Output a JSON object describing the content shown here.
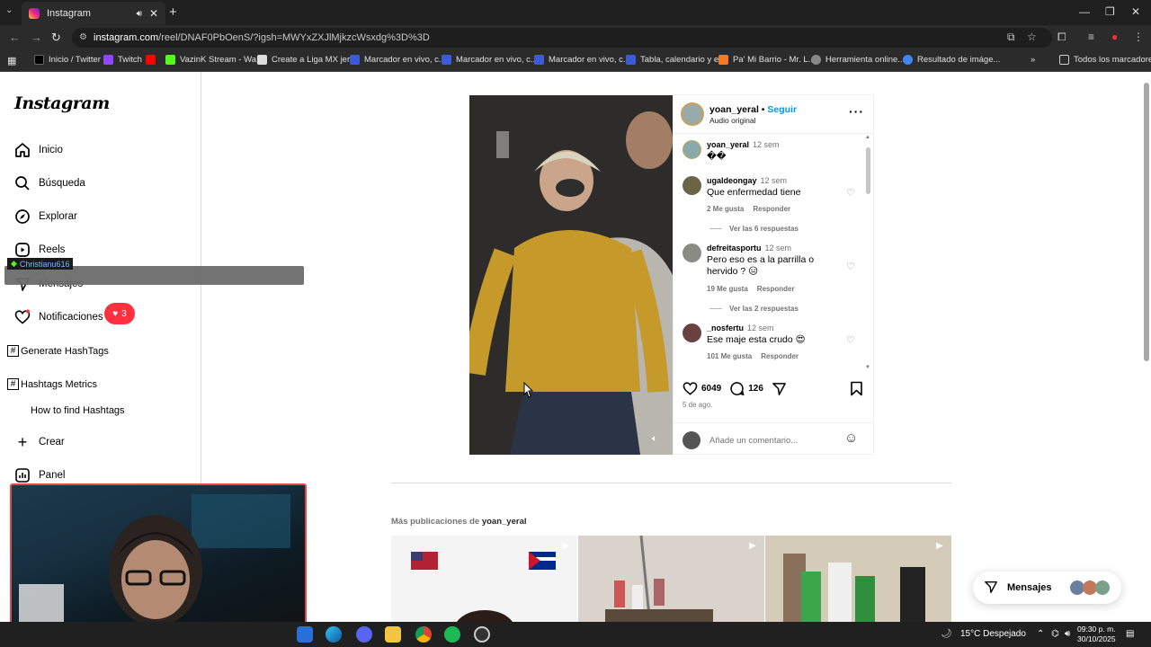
{
  "browser": {
    "tab_title": "Instagram",
    "url_host": "instagram.com",
    "url_path": "/reel/DNAF0PbOenS/?igsh=MWYxZXJlMjkzcWsxdg%3D%3D",
    "bookmarks": [
      "Inicio / Twitter",
      "Twitch",
      "",
      "VazinK Stream - Wa...",
      "Create a Liga MX jer...",
      "Marcador en vivo, c...",
      "Marcador en vivo, c...",
      "Marcador en vivo, c...",
      "Tabla, calendario y e...",
      "Pa' Mi Barrio - Mr. L...",
      "Herramienta online...",
      "Resultado de imáge..."
    ],
    "all_bookmarks": "Todos los marcadores"
  },
  "sidebar": {
    "logo": "Instagram",
    "items": [
      {
        "label": "Inicio",
        "icon": "home-icon"
      },
      {
        "label": "Búsqueda",
        "icon": "search-icon"
      },
      {
        "label": "Explorar",
        "icon": "compass-icon"
      },
      {
        "label": "Reels",
        "icon": "reels-icon"
      },
      {
        "label": "Mensajes",
        "icon": "messenger-icon"
      },
      {
        "label": "Notificaciones",
        "icon": "heart-icon"
      }
    ],
    "notif_count": "3",
    "generate_hashtags": "Generate HashTags",
    "hashtags_metrics": "Hashtags Metrics",
    "how_to": "How to find Hashtags",
    "crear": "Crear",
    "panel": "Panel"
  },
  "overlay": {
    "streamer": "Christianu616"
  },
  "post": {
    "username": "yoan_yeral",
    "follow": "Seguir",
    "audio": "Audio original",
    "caption_user": "yoan_yeral",
    "caption_time": "12 sem",
    "caption_text": "��",
    "comments": [
      {
        "user": "ugaldeongay",
        "time": "12 sem",
        "text": "Que enfermedad tiene",
        "likes": "2 Me gusta",
        "reply": "Responder",
        "replies": "Ver las 6 respuestas"
      },
      {
        "user": "defreitasportu",
        "time": "12 sem",
        "text": "Pero eso es a la parrilla o hervido ? 😑",
        "likes": "19 Me gusta",
        "reply": "Responder",
        "replies": "Ver las 2 respuestas"
      },
      {
        "user": "_nosfertu",
        "time": "12 sem",
        "text": "Ese maje esta crudo 😍",
        "likes": "101 Me gusta",
        "reply": "Responder"
      }
    ],
    "like_count": "6049",
    "comment_count": "126",
    "date": "5 de ago.",
    "add_comment_placeholder": "Añade un comentario..."
  },
  "more": {
    "prefix": "Más publicaciones de",
    "user": "yoan_yeral"
  },
  "messages_pill": "Mensajes",
  "taskbar": {
    "weather": "15°C  Despejado",
    "time": "09:30 p. m.",
    "date": "30/10/2025"
  }
}
